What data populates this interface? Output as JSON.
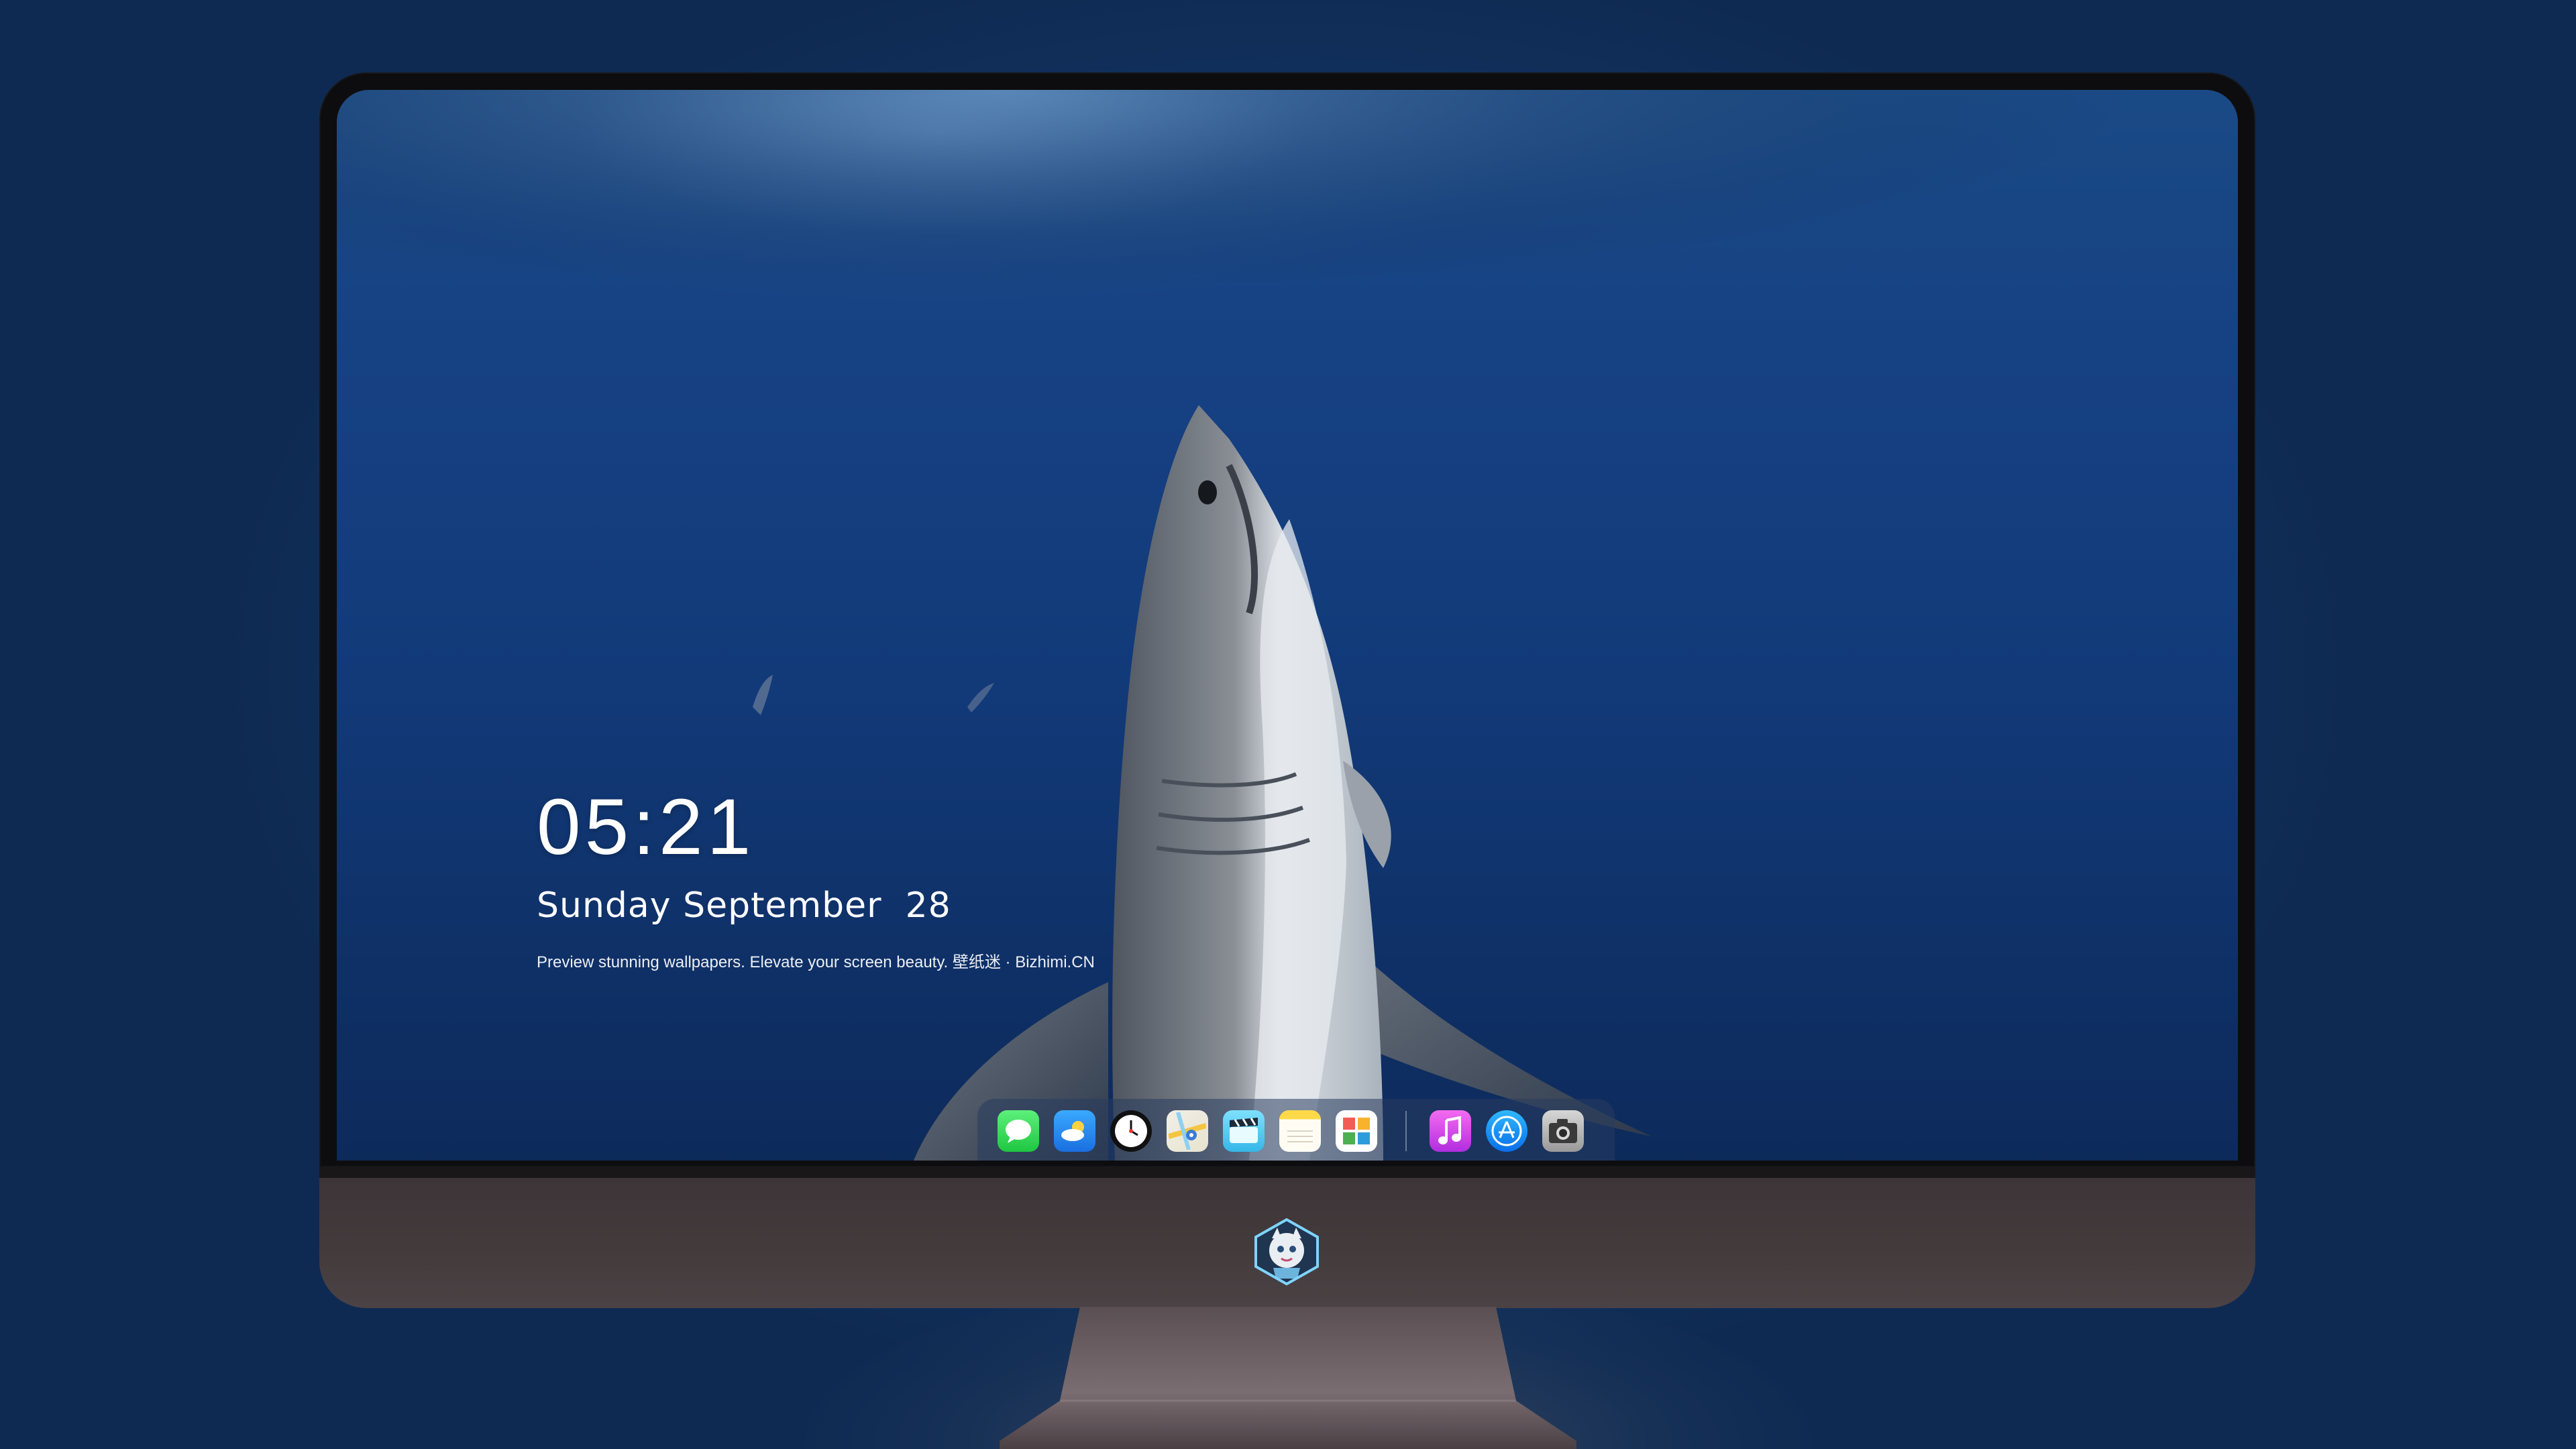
{
  "lockscreen": {
    "time": "05:21",
    "date": "Sunday September  28",
    "caption": "Preview stunning wallpapers. Elevate your screen beauty. 壁纸迷 · Bizhimi.CN"
  },
  "dock": {
    "apps": [
      {
        "name": "messages",
        "icon": "messages-icon"
      },
      {
        "name": "weather",
        "icon": "weather-icon"
      },
      {
        "name": "clock",
        "icon": "clock-icon"
      },
      {
        "name": "maps",
        "icon": "maps-icon"
      },
      {
        "name": "clips",
        "icon": "clips-icon"
      },
      {
        "name": "notes",
        "icon": "notes-icon"
      },
      {
        "name": "photos",
        "icon": "photos-icon"
      },
      {
        "name": "music",
        "icon": "music-icon"
      },
      {
        "name": "app-store",
        "icon": "app-store-icon"
      },
      {
        "name": "camera",
        "icon": "camera-icon"
      }
    ]
  },
  "colors": {
    "background": "#15396a",
    "screen_water": "#123a79",
    "monitor_chin": "#433a3c",
    "bezel": "#0d0d0f"
  },
  "branding": {
    "chin_logo": "bizhimi-mascot-logo"
  }
}
